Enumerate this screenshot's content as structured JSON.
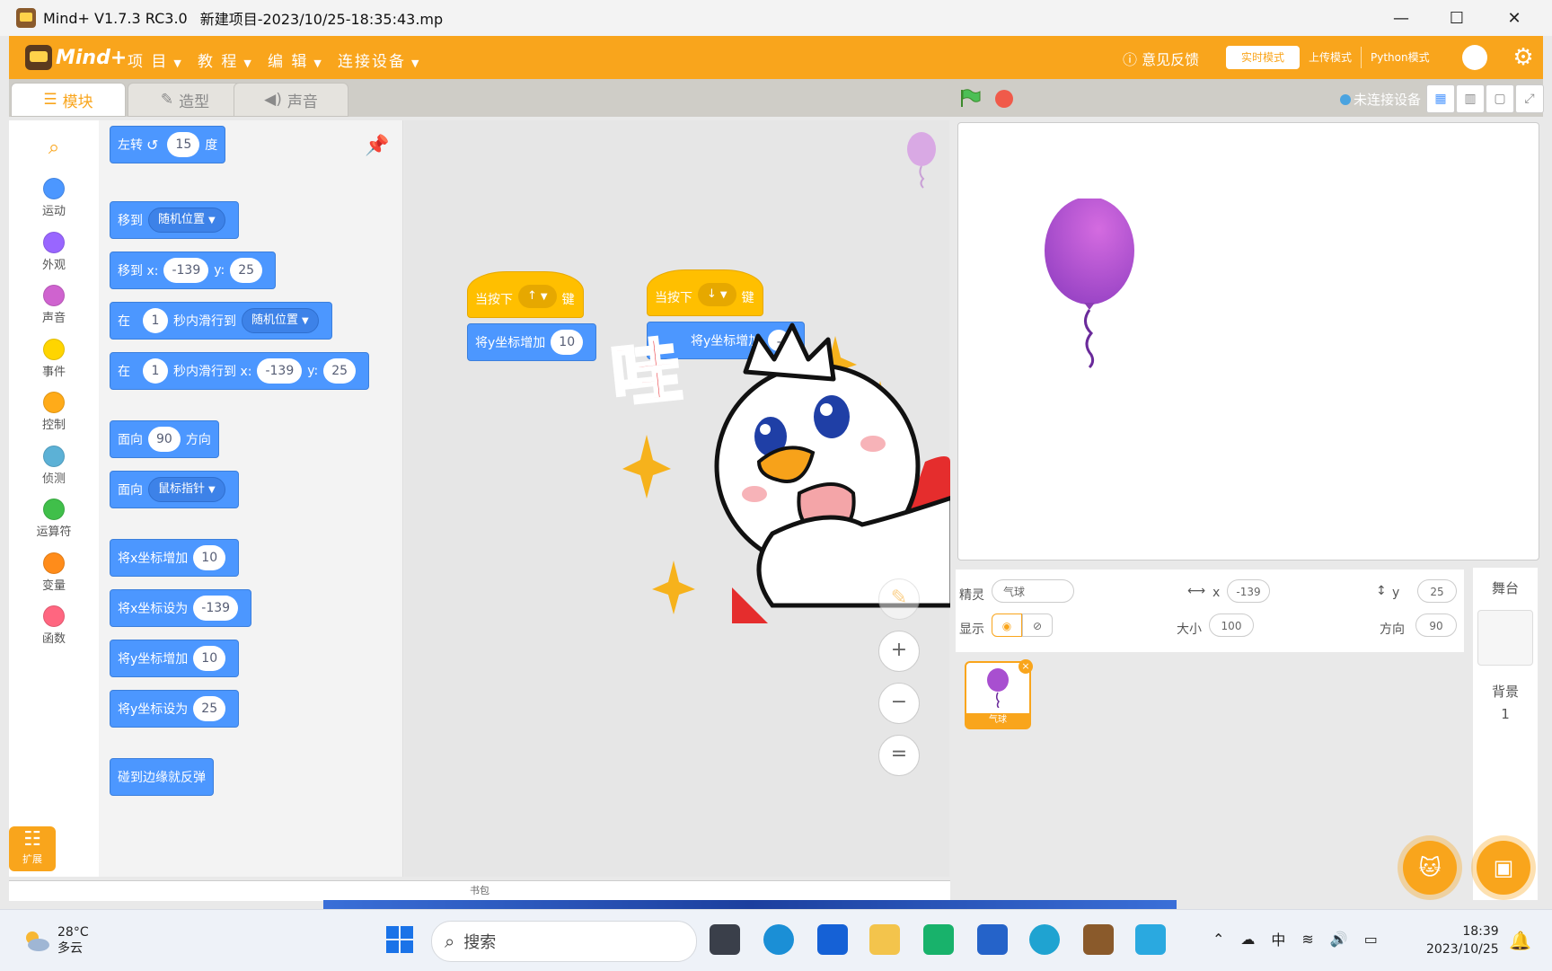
{
  "window": {
    "app_name": "Mind+ V1.7.3 RC3.0",
    "project_title": "新建项目-2023/10/25-18:35:43.mp",
    "minimize": "—",
    "maximize": "☐",
    "close": "✕"
  },
  "header": {
    "logo_text": "Mind+",
    "menus": [
      "项 目",
      "教 程",
      "编 辑",
      "连接设备"
    ],
    "feedback": "意见反馈",
    "modes": [
      "实时模式",
      "上传模式",
      "Python模式"
    ],
    "colors": {
      "brand": "#f9a51c",
      "motion": "#4c97ff",
      "events": "#ffbf00"
    }
  },
  "toolbar": {
    "tabs": [
      "模块",
      "造型",
      "声音"
    ],
    "connection": "未连接设备"
  },
  "categories": [
    {
      "label": "运动",
      "color": "#4c97ff"
    },
    {
      "label": "外观",
      "color": "#9966ff"
    },
    {
      "label": "声音",
      "color": "#cf63cf"
    },
    {
      "label": "事件",
      "color": "#ffd500"
    },
    {
      "label": "控制",
      "color": "#ffab19"
    },
    {
      "label": "侦测",
      "color": "#5cb1d6"
    },
    {
      "label": "运算符",
      "color": "#40bf4a"
    },
    {
      "label": "变量",
      "color": "#ff8c1a"
    },
    {
      "label": "函数",
      "color": "#ff6680"
    }
  ],
  "extension": "扩展",
  "palette": {
    "turn": {
      "a": "左转",
      "value": "15",
      "b": "度"
    },
    "goto": {
      "a": "移到",
      "dropdown": "随机位置"
    },
    "goto_xy": {
      "a": "移到 x:",
      "x": "-139",
      "b": "y:",
      "y": "25"
    },
    "glide_to": {
      "a": "在",
      "secs": "1",
      "b": "秒内滑行到",
      "dropdown": "随机位置"
    },
    "glide_xy": {
      "a": "在",
      "secs": "1",
      "b": "秒内滑行到 x:",
      "x": "-139",
      "c": "y:",
      "y": "25"
    },
    "point_dir": {
      "a": "面向",
      "value": "90",
      "b": "方向"
    },
    "point_towards": {
      "a": "面向",
      "dropdown": "鼠标指针"
    },
    "change_x": {
      "a": "将x坐标增加",
      "value": "10"
    },
    "set_x": {
      "a": "将x坐标设为",
      "value": "-139"
    },
    "change_y": {
      "a": "将y坐标增加",
      "value": "10"
    },
    "set_y": {
      "a": "将y坐标设为",
      "value": "25"
    },
    "bounce": {
      "a": "碰到边缘就反弹"
    }
  },
  "scripts": {
    "script1": {
      "hat_a": "当按下",
      "key": "↑",
      "hat_b": "键",
      "stack_a": "将y坐标增加",
      "stack_value": "10"
    },
    "script2": {
      "hat_a": "当按下",
      "key": "↓",
      "hat_b": "键",
      "stack_a": "将y坐标增加",
      "stack_value": "-"
    },
    "sticker_text": "哇",
    "zoom_in": "+",
    "zoom_out": "−",
    "zoom_reset": "="
  },
  "backpack": "书包",
  "sprite": {
    "label_sprite": "精灵",
    "name": "气球",
    "label_x": "x",
    "x": "-139",
    "label_y": "y",
    "y": "25",
    "label_show": "显示",
    "label_size": "大小",
    "size": "100",
    "label_direction": "方向",
    "direction": "90",
    "card_name": "气球"
  },
  "stage_panel": {
    "title": "舞台",
    "backdrop_label": "背景",
    "backdrop_count": "1"
  },
  "taskbar": {
    "temp": "28°C",
    "weather": "多云",
    "search": "搜索",
    "ime": "中",
    "time": "18:39",
    "date": "2023/10/25"
  }
}
